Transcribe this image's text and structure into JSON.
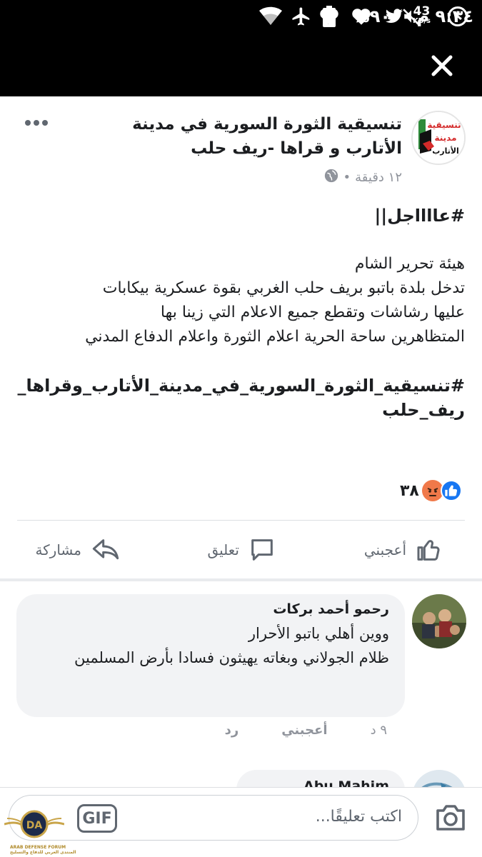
{
  "status_bar": {
    "time": "٩:٣٤ م",
    "battery_percent": "%٩٠",
    "net_speed_value": "43",
    "net_speed_unit": "KB/s",
    "icons": [
      "mute-icon",
      "wifi-icon",
      "airplane-icon",
      "battery-charging-icon",
      "twitter-icon",
      "heart-icon",
      "heart-icon",
      "heart-icon",
      "clock-icon"
    ]
  },
  "post": {
    "page_name": "تنسيقية الثورة السورية في مدينة الأتارب و قراها -ريف حلب",
    "avatar_lines": [
      "تنسيقية",
      "مدينة",
      "الأتارب"
    ],
    "time": "١٢ دقيقة",
    "separator": "•",
    "privacy_icon": "globe-icon",
    "body": {
      "headline": "#عااااجل||",
      "lines": [
        "هيئة تحرير الشام",
        "تدخل بلدة باتبو بريف حلب الغربي بقوة عسكرية بيكابات",
        "عليها رشاشات  وتقطع جميع الاعلام التي زينا بها",
        "المتظاهرين ساحة الحرية اعلام الثورة واعلام الدفاع المدني"
      ],
      "hashtag": "#تنسيقية_الثورة_السورية_في_مدينة_الأتارب_وقراها_ريف_حلب"
    },
    "reactions": {
      "count": "٣٨",
      "types": [
        "like",
        "angry"
      ]
    },
    "actions": {
      "like": "أعجبني",
      "comment": "تعليق",
      "share": "مشاركة"
    }
  },
  "comments": [
    {
      "author": "رحمو أحمد بركات",
      "text_lines": [
        "ووين أهلي باتبو الأحرار",
        "ظلام الجولاني وبغاته يهيثون فسادا بأرض المسلمين"
      ],
      "time": "٩ د",
      "like_label": "أعجبني",
      "reply_label": "رد"
    },
    {
      "author": "Abu Mahim"
    }
  ],
  "composer": {
    "placeholder": "اكتب تعليقًا...",
    "gif_label": "GIF"
  },
  "watermark": {
    "badge": "DA",
    "text": "ARAB DEFENSE FORUM",
    "subtext": "المنتدى العربي للدفاع والتسليح"
  },
  "colors": {
    "facebook_blue": "#1877f2",
    "angry_orange": "#f0794a",
    "text_primary": "#1c1e21",
    "text_secondary": "#606770",
    "comment_bg": "#f2f3f5"
  }
}
